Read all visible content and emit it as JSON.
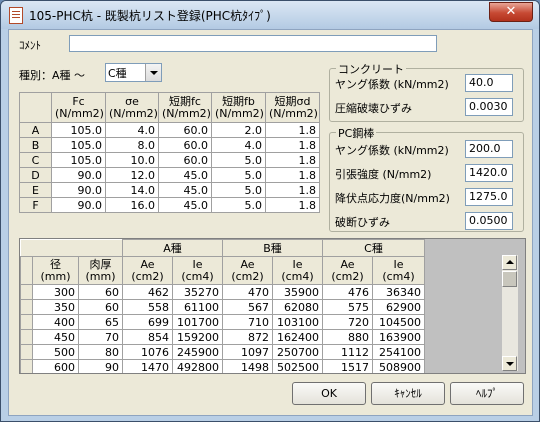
{
  "window": {
    "title": "105-PHC杭 - 既製杭リスト登録(PHC杭ﾀｲﾌﾟ)",
    "close": "✕"
  },
  "comment": {
    "label": "ｺﾒﾝﾄ",
    "value": ""
  },
  "type_select": {
    "label": "種別：A種 ～",
    "value": "C種"
  },
  "grade_table": {
    "headers": [
      "Fc (N/mm2)",
      "σe (N/mm2)",
      "短期fc (N/mm2)",
      "短期fb (N/mm2)",
      "短期σd (N/mm2)"
    ],
    "rows": [
      {
        "key": "A",
        "v": [
          "105.0",
          "4.0",
          "60.0",
          "2.0",
          "1.8"
        ]
      },
      {
        "key": "B",
        "v": [
          "105.0",
          "8.0",
          "60.0",
          "4.0",
          "1.8"
        ]
      },
      {
        "key": "C",
        "v": [
          "105.0",
          "10.0",
          "60.0",
          "5.0",
          "1.8"
        ]
      },
      {
        "key": "D",
        "v": [
          "90.0",
          "12.0",
          "45.0",
          "5.0",
          "1.8"
        ]
      },
      {
        "key": "E",
        "v": [
          "90.0",
          "14.0",
          "45.0",
          "5.0",
          "1.8"
        ]
      },
      {
        "key": "F",
        "v": [
          "90.0",
          "16.0",
          "45.0",
          "5.0",
          "1.8"
        ]
      }
    ]
  },
  "concrete": {
    "title": "コンクリート",
    "young_label": "ヤング係数 (kN/mm2)",
    "young_value": "40.0",
    "strain_label": "圧縮破壊ひずみ",
    "strain_value": "0.0030"
  },
  "steel": {
    "title": "PC鋼棒",
    "young_label": "ヤング係数 (kN/mm2)",
    "young_value": "200.0",
    "tensile_label": "引張強度 (N/mm2)",
    "tensile_value": "1420.0",
    "yield_label": "降伏点応力度(N/mm2)",
    "yield_value": "1275.0",
    "break_label": "破断ひずみ",
    "break_value": "0.0500"
  },
  "pile_table": {
    "group_headers": [
      "A種",
      "B種",
      "C種"
    ],
    "sub_headers": [
      "径 (mm)",
      "肉厚 (mm)",
      "Ae (cm2)",
      "Ie (cm4)",
      "Ae (cm2)",
      "Ie (cm4)",
      "Ae (cm2)",
      "Ie (cm4)"
    ],
    "rows": [
      [
        "300",
        "60",
        "462",
        "35270",
        "470",
        "35900",
        "476",
        "36340"
      ],
      [
        "350",
        "60",
        "558",
        "61100",
        "567",
        "62080",
        "575",
        "62900"
      ],
      [
        "400",
        "65",
        "699",
        "101700",
        "710",
        "103100",
        "720",
        "104500"
      ],
      [
        "450",
        "70",
        "854",
        "159200",
        "872",
        "162400",
        "880",
        "163900"
      ],
      [
        "500",
        "80",
        "1076",
        "245900",
        "1097",
        "250700",
        "1112",
        "254100"
      ],
      [
        "600",
        "90",
        "1470",
        "492800",
        "1498",
        "502500",
        "1517",
        "508900"
      ]
    ]
  },
  "buttons": {
    "ok": "OK",
    "cancel": "ｷｬﾝｾﾙ",
    "help": "ﾍﾙﾌﾟ"
  }
}
